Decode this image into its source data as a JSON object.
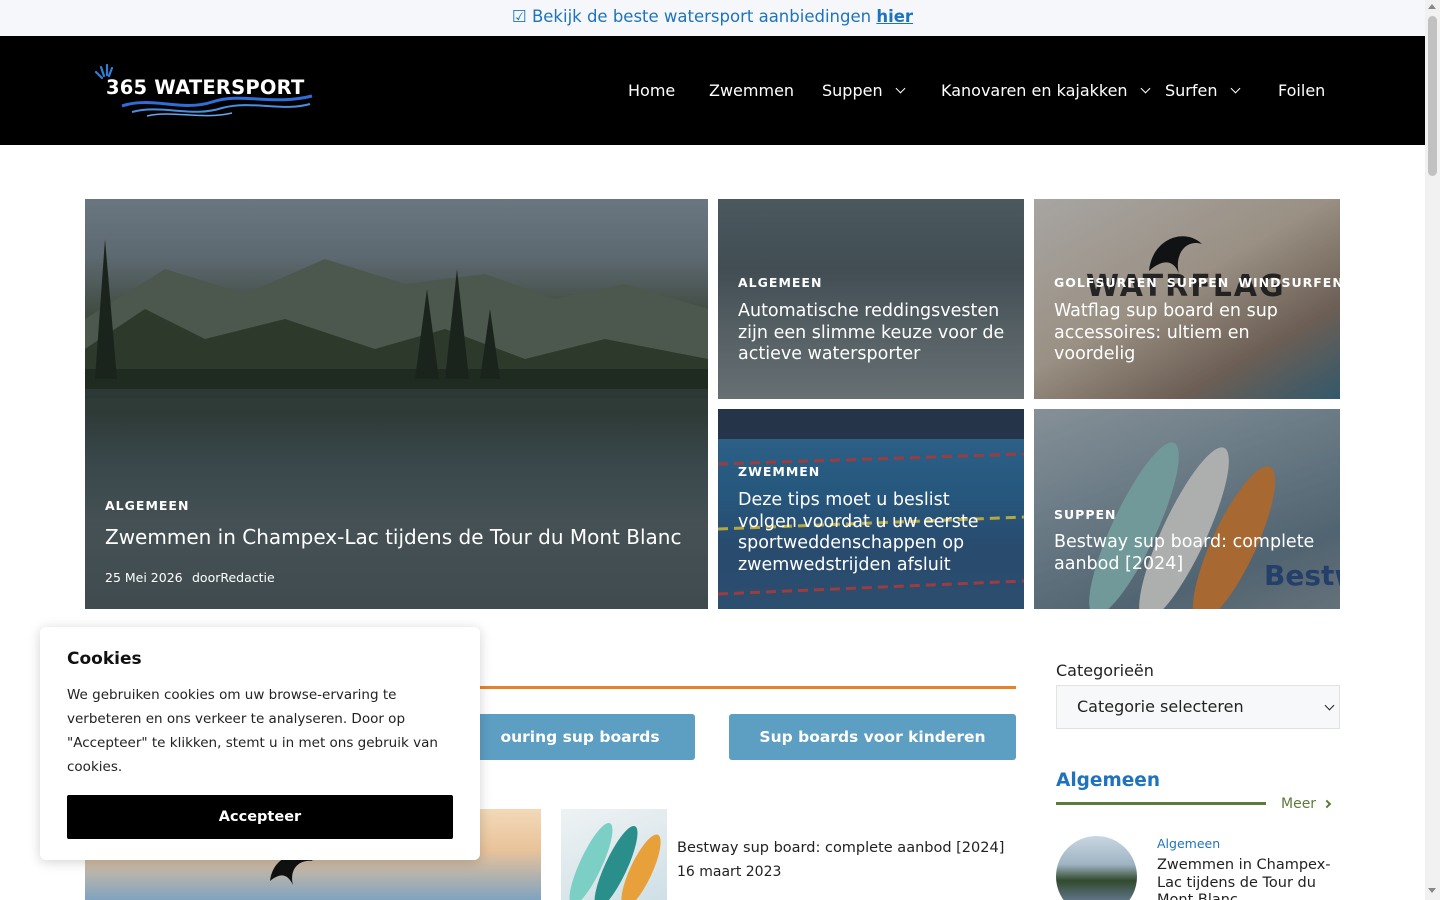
{
  "promo": {
    "prefix": "☑ Bekijk de beste watersport aanbiedingen ",
    "link": "hier"
  },
  "header": {
    "logo_text": "365 WATERSPORT",
    "nav": [
      {
        "label": "Home"
      },
      {
        "label": "Zwemmen"
      },
      {
        "label": "Suppen"
      },
      {
        "label": "Kanovaren en kajakken"
      },
      {
        "label": "Surfen"
      },
      {
        "label": "Foilen"
      }
    ]
  },
  "hero": {
    "main": {
      "category": "ALGEMEEN",
      "title": "Zwemmen in Champex-Lac tijdens de Tour du Mont Blanc",
      "date": "25 Mei 2026",
      "author": "doorRedactie"
    },
    "cards": [
      {
        "categories": [
          "ALGEMEEN"
        ],
        "title": "Automatische reddingsvesten zijn een slimme keuze voor de actieve watersporter"
      },
      {
        "categories": [
          "GOLFSURFEN",
          "SUPPEN",
          "WINDSURFEN"
        ],
        "title": "Watflag sup board en sup accessoires: ultiem en voordelig",
        "image_text": "WATRFLAG"
      },
      {
        "categories": [
          "ZWEMMEN"
        ],
        "title": "Deze tips moet u beslist volgen voordat u uw eerste sportweddenschappen op zwemwedstrijden afsluit"
      },
      {
        "categories": [
          "SUPPEN"
        ],
        "title": "Bestway sup board: complete aanbod [2024]",
        "image_text": "Bestw"
      }
    ]
  },
  "section": {
    "buttons": [
      "ouring sup boards",
      "Sup boards voor kinderen"
    ],
    "post": {
      "title": "Bestway sup board: complete aanbod [2024]",
      "date": "16 maart 2023"
    }
  },
  "sidebar": {
    "categories_label": "Categorieën",
    "select_value": "Categorie selecteren",
    "heading": "Algemeen",
    "more": "Meer",
    "post_category": "Algemeen",
    "post_title": "Zwemmen in Champex-Lac tijdens de Tour du Mont Blanc"
  },
  "cookie": {
    "title": "Cookies",
    "text": "We gebruiken cookies om uw browse-ervaring te verbeteren en ons verkeer te analyseren. Door op \"Accepteer\" te klikken, stemt u in met ons gebruik van cookies.",
    "button": "Accepteer"
  },
  "colors": {
    "accent_blue": "#1e73be",
    "button_blue": "#5d9ec3",
    "orange": "#e8822a",
    "green": "#5c7a3a",
    "header_bg": "#000000"
  }
}
